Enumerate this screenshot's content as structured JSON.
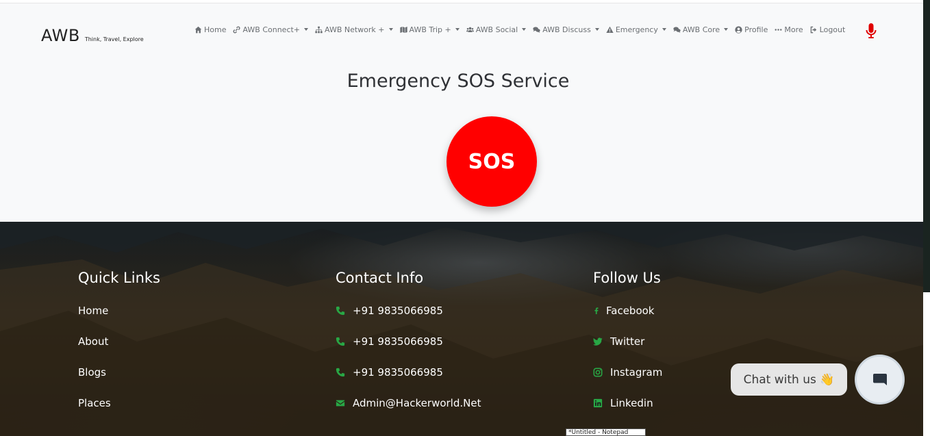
{
  "brand": {
    "name": "AWB",
    "tagline": "Think, Travel, Explore"
  },
  "nav": {
    "items": [
      {
        "label": "Home",
        "icon": "home-icon",
        "dropdown": false
      },
      {
        "label": "AWB Connect+",
        "icon": "link-icon",
        "dropdown": true
      },
      {
        "label": "AWB Network +",
        "icon": "sitemap-icon",
        "dropdown": true
      },
      {
        "label": "AWB Trip +",
        "icon": "map-icon",
        "dropdown": true
      },
      {
        "label": "AWB Social",
        "icon": "users-icon",
        "dropdown": true
      },
      {
        "label": "AWB Discuss",
        "icon": "comments-icon",
        "dropdown": true
      },
      {
        "label": "Emergency",
        "icon": "warning-icon",
        "dropdown": true
      },
      {
        "label": "AWB Core",
        "icon": "comments-icon",
        "dropdown": true
      },
      {
        "label": "Profile",
        "icon": "user-circle-icon",
        "dropdown": false
      },
      {
        "label": "More",
        "icon": "ellipsis-icon",
        "dropdown": false
      },
      {
        "label": "Logout",
        "icon": "logout-icon",
        "dropdown": false
      }
    ],
    "mic_icon": "microphone-icon"
  },
  "main": {
    "title": "Emergency SOS Service",
    "sos_label": "SOS"
  },
  "footer": {
    "quick_links": {
      "title": "Quick Links",
      "items": [
        "Home",
        "About",
        "Blogs",
        "Places"
      ]
    },
    "contact": {
      "title": "Contact Info",
      "items": [
        {
          "icon": "phone-icon",
          "text": "+91 9835066985"
        },
        {
          "icon": "phone-icon",
          "text": "+91 9835066985"
        },
        {
          "icon": "phone-icon",
          "text": "+91 9835066985"
        },
        {
          "icon": "envelope-icon",
          "text": "Admin@Hackerworld.Net"
        }
      ]
    },
    "follow": {
      "title": "Follow Us",
      "items": [
        {
          "icon": "facebook-icon",
          "text": "Facebook"
        },
        {
          "icon": "twitter-icon",
          "text": "Twitter"
        },
        {
          "icon": "instagram-icon",
          "text": "Instagram"
        },
        {
          "icon": "linkedin-icon",
          "text": "Linkedin"
        }
      ]
    }
  },
  "chat": {
    "label": "Chat with us 👋",
    "button_icon": "chat-bubble-icon"
  },
  "taskbar_tooltip": "*Untitled - Notepad",
  "colors": {
    "sos": "#ff0000",
    "accent_green": "#28a745",
    "mic": "#e00000"
  }
}
